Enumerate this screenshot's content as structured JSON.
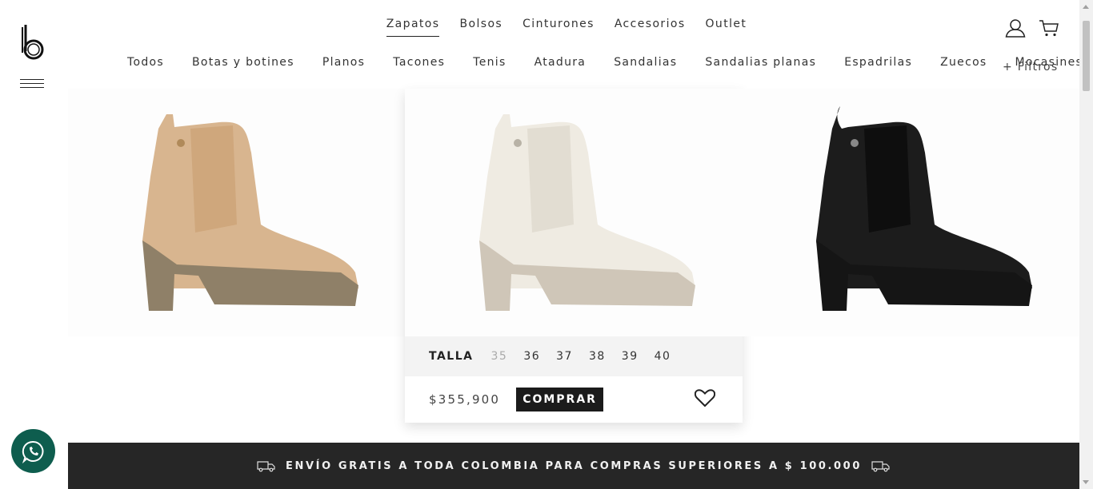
{
  "brand": {
    "logo_icon": "b-logo-icon"
  },
  "top_nav": [
    {
      "label": "Zapatos",
      "active": true
    },
    {
      "label": "Bolsos"
    },
    {
      "label": "Cinturones"
    },
    {
      "label": "Accesorios"
    },
    {
      "label": "Outlet"
    }
  ],
  "sub_nav": [
    "Todos",
    "Botas y botines",
    "Planos",
    "Tacones",
    "Tenis",
    "Atadura",
    "Sandalias",
    "Sandalias planas",
    "Espadrilas",
    "Zuecos",
    "Mocasines"
  ],
  "filters_label": "+ Filtros",
  "products": [
    {
      "color": "#d8b58f",
      "sole": "#8f8068"
    },
    {
      "color": "#efebe2",
      "sole": "#cfc6b8",
      "size_label": "TALLA",
      "sizes": [
        "35",
        "36",
        "37",
        "38",
        "39",
        "40"
      ],
      "disabled_sizes": [
        "35"
      ],
      "price": "$355,900",
      "buy_label": "COMPRAR"
    },
    {
      "color": "#1c1c1c",
      "sole": "#151515"
    }
  ],
  "banner": {
    "text": "ENVÍO GRATIS A TODA COLOMBIA PARA COMPRAS SUPERIORES A $ 100.000"
  },
  "icons": {
    "user": "user-icon",
    "cart": "cart-icon",
    "heart": "heart-icon",
    "whatsapp": "whatsapp-icon",
    "truck": "truck-icon"
  }
}
